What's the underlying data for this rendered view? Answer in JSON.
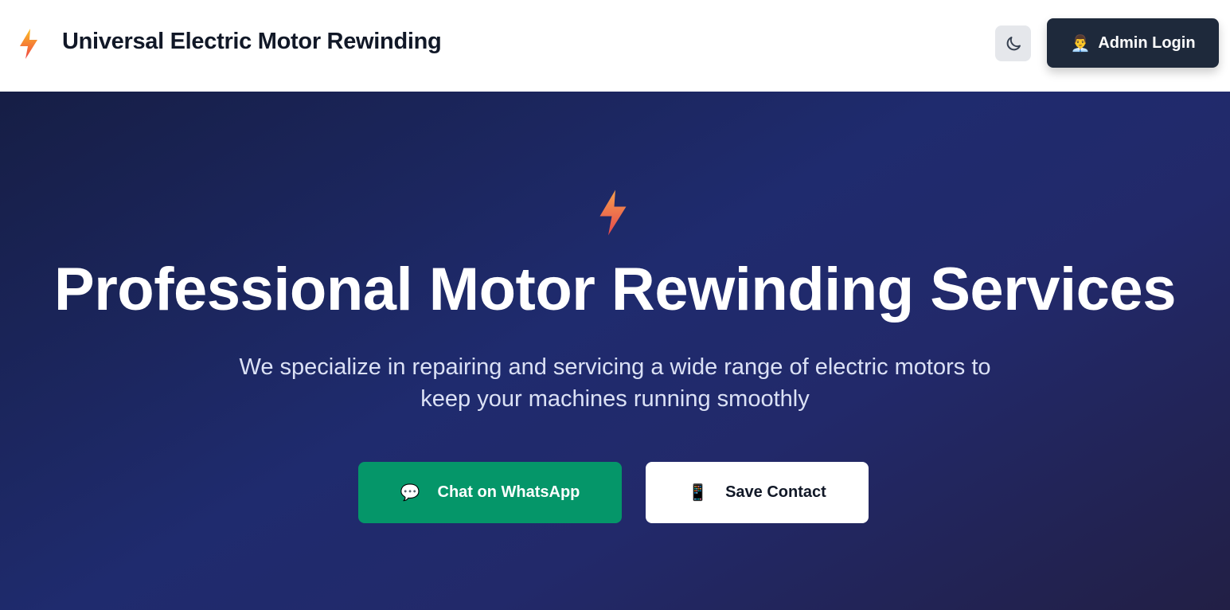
{
  "header": {
    "title": "Universal Electric Motor Rewinding",
    "theme_toggle_icon": "moon-icon",
    "admin_login_label": "Admin Login",
    "admin_icon": "👨‍💼"
  },
  "hero": {
    "title": "Professional Motor Rewinding Services",
    "subtitle_line1": "We specialize in repairing and servicing a wide range of electric motors to",
    "subtitle_line2": "keep your machines running smoothly",
    "whatsapp_label": "Chat on WhatsApp",
    "whatsapp_icon": "💬",
    "save_contact_label": "Save Contact",
    "save_contact_icon": "📱"
  },
  "colors": {
    "accent_green": "#059669",
    "dark": "#1e293b",
    "bolt_top": "#fbbf24",
    "bolt_bottom": "#ef4444"
  }
}
